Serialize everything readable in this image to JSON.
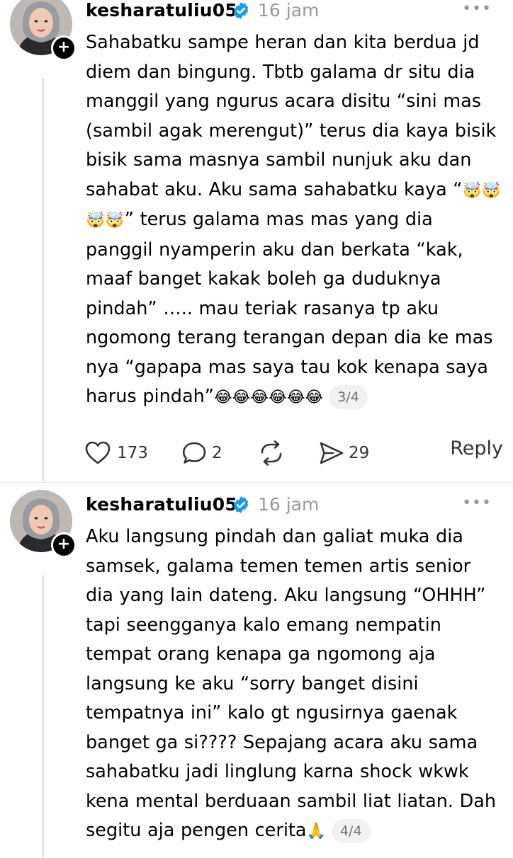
{
  "posts": [
    {
      "username": "kesharatuliu05",
      "time": "16 jam",
      "text_before_emoji": "Sahabatku sampe heran dan kita berdua jd diem dan bingung. Tbtb galama dr situ dia manggil yang ngurus acara disitu “sini mas (sambil agak merengut)” terus dia kaya bisik bisik sama masnya sambil nunjuk aku dan sahabat aku. Aku sama sahabatku kaya “",
      "emoji_1": "🤯🤯🤯🤯",
      "text_middle": "” terus galama mas mas yang dia panggil nyamperin aku dan berkata “kak, maaf banget kakak boleh ga duduknya pindah” ….. mau teriak rasanya tp aku ngomong terang terangan depan dia ke mas nya “gapapa mas saya tau kok kenapa saya harus pindah”",
      "emoji_2": "😂😂😂😂😂😂",
      "page": "3/4",
      "likes": "173",
      "comments": "2",
      "shares": "29",
      "reply_label": "Reply"
    },
    {
      "username": "kesharatuliu05",
      "time": "16 jam",
      "text_before_emoji": "Aku langsung pindah dan galiat muka dia samsek, galama temen temen artis senior dia yang lain dateng. Aku langsung “OHHH” tapi seengganya kalo emang nempatin tempat orang kenapa ga ngomong aja langsung ke aku “sorry banget disini tempatnya ini” kalo gt ngusirnya gaenak banget ga si???? Sepajang acara aku sama sahabatku jadi linglung karna shock wkwk kena mental berduaan sambil liat liatan. Dah segitu aja pengen cerita",
      "emoji_1": "🙏",
      "page": "4/4"
    }
  ],
  "icons": {
    "verified_color": "#1d9bf0"
  }
}
